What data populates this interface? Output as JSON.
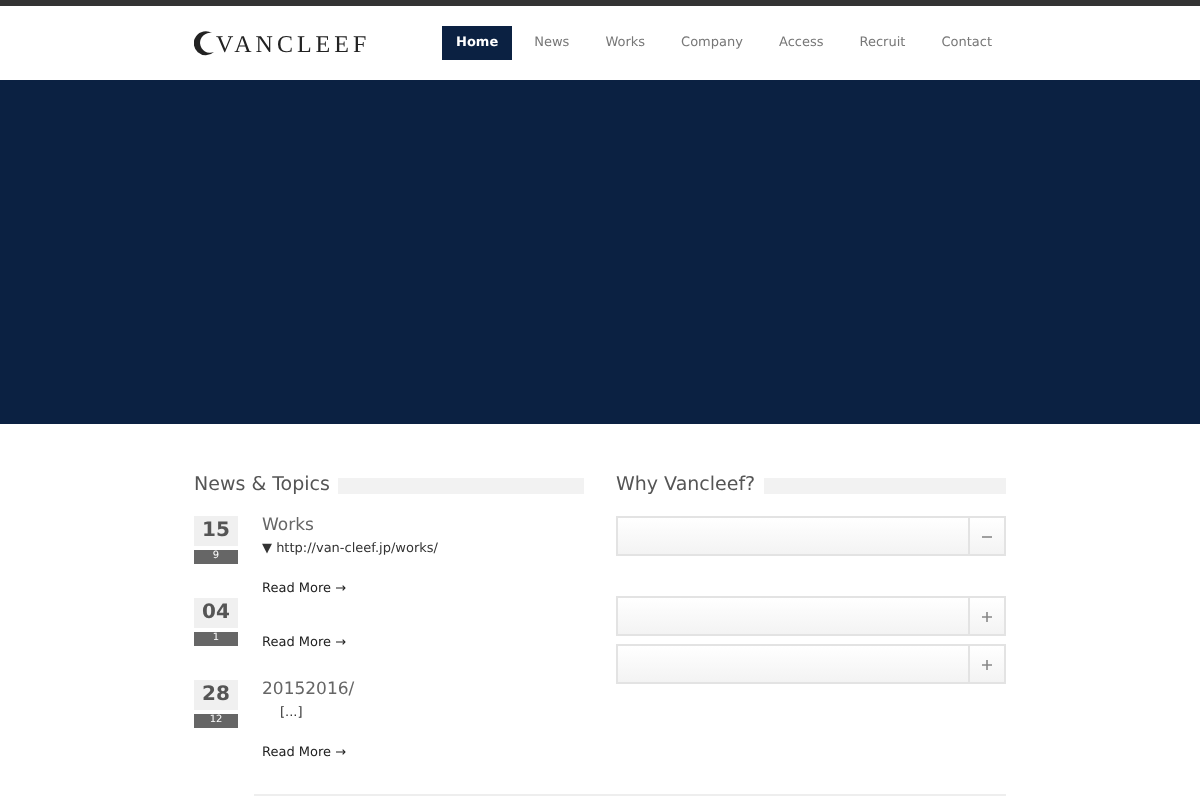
{
  "header": {
    "logo": "VANCLEEF",
    "nav": [
      {
        "label": "Home",
        "selected": true
      },
      {
        "label": "News",
        "selected": false
      },
      {
        "label": "Works",
        "selected": false
      },
      {
        "label": "Company",
        "selected": false
      },
      {
        "label": "Access",
        "selected": false
      },
      {
        "label": "Recruit",
        "selected": false
      },
      {
        "label": "Contact",
        "selected": false
      }
    ]
  },
  "hero": {
    "kind": "banner"
  },
  "news": {
    "title": "News & Topics",
    "items": [
      {
        "day": "15",
        "month": "9",
        "title": "Works",
        "excerpt": "▼ http://van-cleef.jp/works/",
        "link": "Read More →"
      },
      {
        "day": "04",
        "month": "1",
        "link": "Read More →"
      },
      {
        "day": "28",
        "month": "12",
        "title": "20152016/",
        "excerpt": "[...]",
        "link": "Read More →"
      }
    ]
  },
  "why": {
    "title": "Why Vancleef?",
    "panels": [
      {
        "expanded": true
      },
      {
        "expanded": false
      },
      {
        "expanded": false
      }
    ]
  }
}
